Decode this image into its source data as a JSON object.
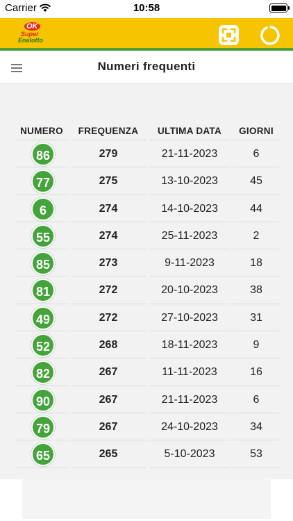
{
  "status": {
    "carrier": "Carrier",
    "time": "10:58"
  },
  "app": {
    "logo_ok": "OK",
    "logo_line1": "Super",
    "logo_line2": "Enalotto"
  },
  "header": {
    "title": "Numeri frequenti"
  },
  "table": {
    "columns": [
      "NUMERO",
      "FREQUENZA",
      "ULTIMA DATA",
      "GIORNI"
    ],
    "rows": [
      {
        "numero": "86",
        "frequenza": "279",
        "data": "21-11-2023",
        "giorni": "6"
      },
      {
        "numero": "77",
        "frequenza": "275",
        "data": "13-10-2023",
        "giorni": "45"
      },
      {
        "numero": "6",
        "frequenza": "274",
        "data": "14-10-2023",
        "giorni": "44"
      },
      {
        "numero": "55",
        "frequenza": "274",
        "data": "25-11-2023",
        "giorni": "2"
      },
      {
        "numero": "85",
        "frequenza": "273",
        "data": "9-11-2023",
        "giorni": "18"
      },
      {
        "numero": "81",
        "frequenza": "272",
        "data": "20-10-2023",
        "giorni": "38"
      },
      {
        "numero": "49",
        "frequenza": "272",
        "data": "27-10-2023",
        "giorni": "31"
      },
      {
        "numero": "52",
        "frequenza": "268",
        "data": "18-11-2023",
        "giorni": "9"
      },
      {
        "numero": "82",
        "frequenza": "267",
        "data": "11-11-2023",
        "giorni": "16"
      },
      {
        "numero": "90",
        "frequenza": "267",
        "data": "21-11-2023",
        "giorni": "6"
      },
      {
        "numero": "79",
        "frequenza": "267",
        "data": "24-10-2023",
        "giorni": "34"
      },
      {
        "numero": "65",
        "frequenza": "265",
        "data": "5-10-2023",
        "giorni": "53"
      }
    ]
  },
  "colors": {
    "appbar": "#f6c400",
    "accent_green": "#45a33b",
    "content_bg": "#f2f2f2"
  },
  "icons": {
    "menu": "hamburger-menu-icon",
    "expand": "expand-icon",
    "refresh": "refresh-icon",
    "wifi": "wifi-icon",
    "battery": "battery-icon"
  }
}
